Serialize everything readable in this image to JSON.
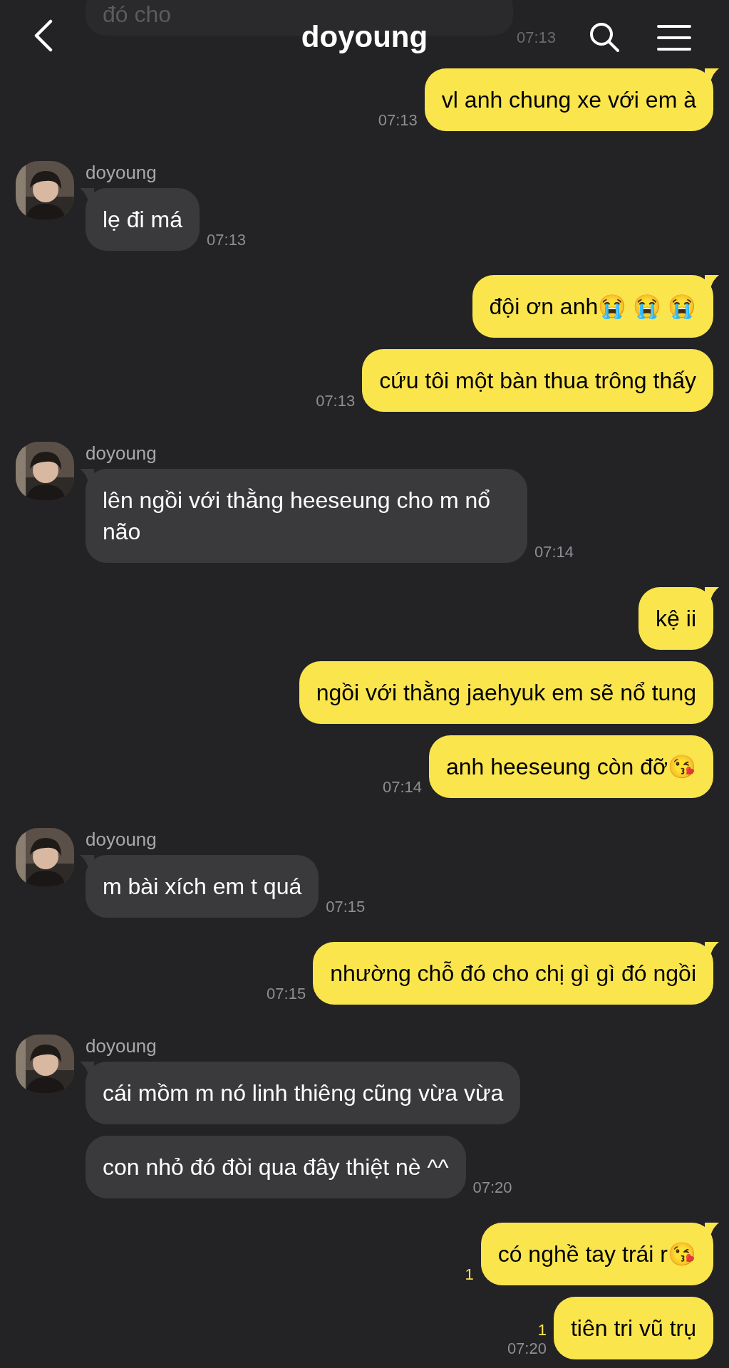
{
  "header": {
    "title": "doyoung",
    "backdrop": {
      "text": "đó cho",
      "time": "07:13"
    }
  },
  "groups": [
    {
      "kind": "sent",
      "messages": [
        {
          "text": "vl anh chung xe với em à",
          "time": "07:13"
        }
      ]
    },
    {
      "kind": "received",
      "sender": "doyoung",
      "messages": [
        {
          "text": "lẹ đi má",
          "time": "07:13"
        }
      ]
    },
    {
      "kind": "sent",
      "messages": [
        {
          "text": "đội ơn anh😭 😭 😭"
        },
        {
          "text": "cứu tôi một bàn thua trông thấy",
          "time": "07:13"
        }
      ]
    },
    {
      "kind": "received",
      "sender": "doyoung",
      "messages": [
        {
          "text": "lên ngồi với thằng heeseung cho m nổ não",
          "time": "07:14"
        }
      ]
    },
    {
      "kind": "sent",
      "messages": [
        {
          "text": "kệ ii"
        },
        {
          "text": "ngồi với thằng jaehyuk em sẽ nổ tung"
        },
        {
          "text": "anh heeseung còn đỡ😘",
          "time": "07:14"
        }
      ]
    },
    {
      "kind": "received",
      "sender": "doyoung",
      "messages": [
        {
          "text": "m bài xích em t quá",
          "time": "07:15"
        }
      ]
    },
    {
      "kind": "sent",
      "messages": [
        {
          "text": "nhường chỗ đó cho chị gì gì đó ngồi",
          "time": "07:15"
        }
      ]
    },
    {
      "kind": "received",
      "sender": "doyoung",
      "messages": [
        {
          "text": "cái mồm m nó linh thiêng cũng vừa vừa"
        },
        {
          "text": "con nhỏ đó đòi qua đây thiệt nè ^^",
          "time": "07:20"
        }
      ]
    },
    {
      "kind": "sent",
      "messages": [
        {
          "text": "có nghề tay trái r😘",
          "unread": "1"
        },
        {
          "text": "tiên tri vũ trụ",
          "unread": "1",
          "time": "07:20"
        }
      ]
    }
  ]
}
